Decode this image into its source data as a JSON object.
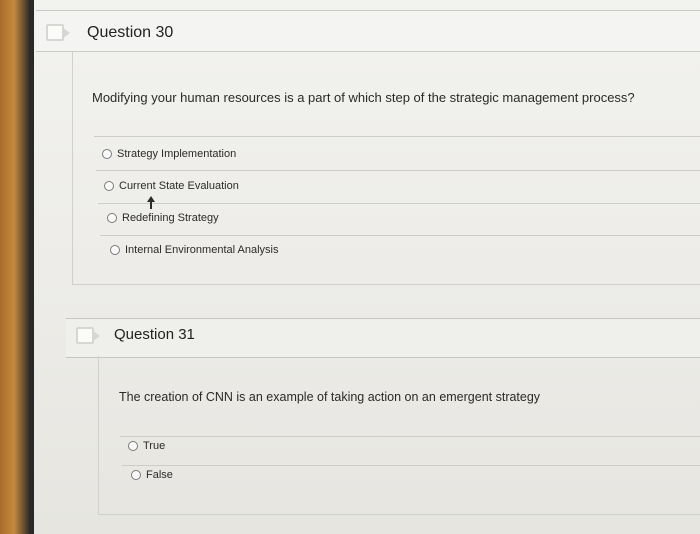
{
  "questions": [
    {
      "title": "Question 30",
      "prompt": "Modifying your human resources is a part of which step of the strategic management process?",
      "options": [
        "Strategy Implementation",
        "Current State Evaluation",
        "Redefining Strategy",
        "Internal Environmental Analysis"
      ]
    },
    {
      "title": "Question 31",
      "prompt": "The creation of CNN is an example of taking action on an emergent strategy",
      "options": [
        "True",
        "False"
      ]
    }
  ],
  "icons": {
    "flag": "flag-icon",
    "cursor": "mouse-pointer-icon"
  },
  "colors": {
    "header_bg": "#f4f4f2",
    "text": "#222222",
    "divider": "#cdcdc9"
  }
}
